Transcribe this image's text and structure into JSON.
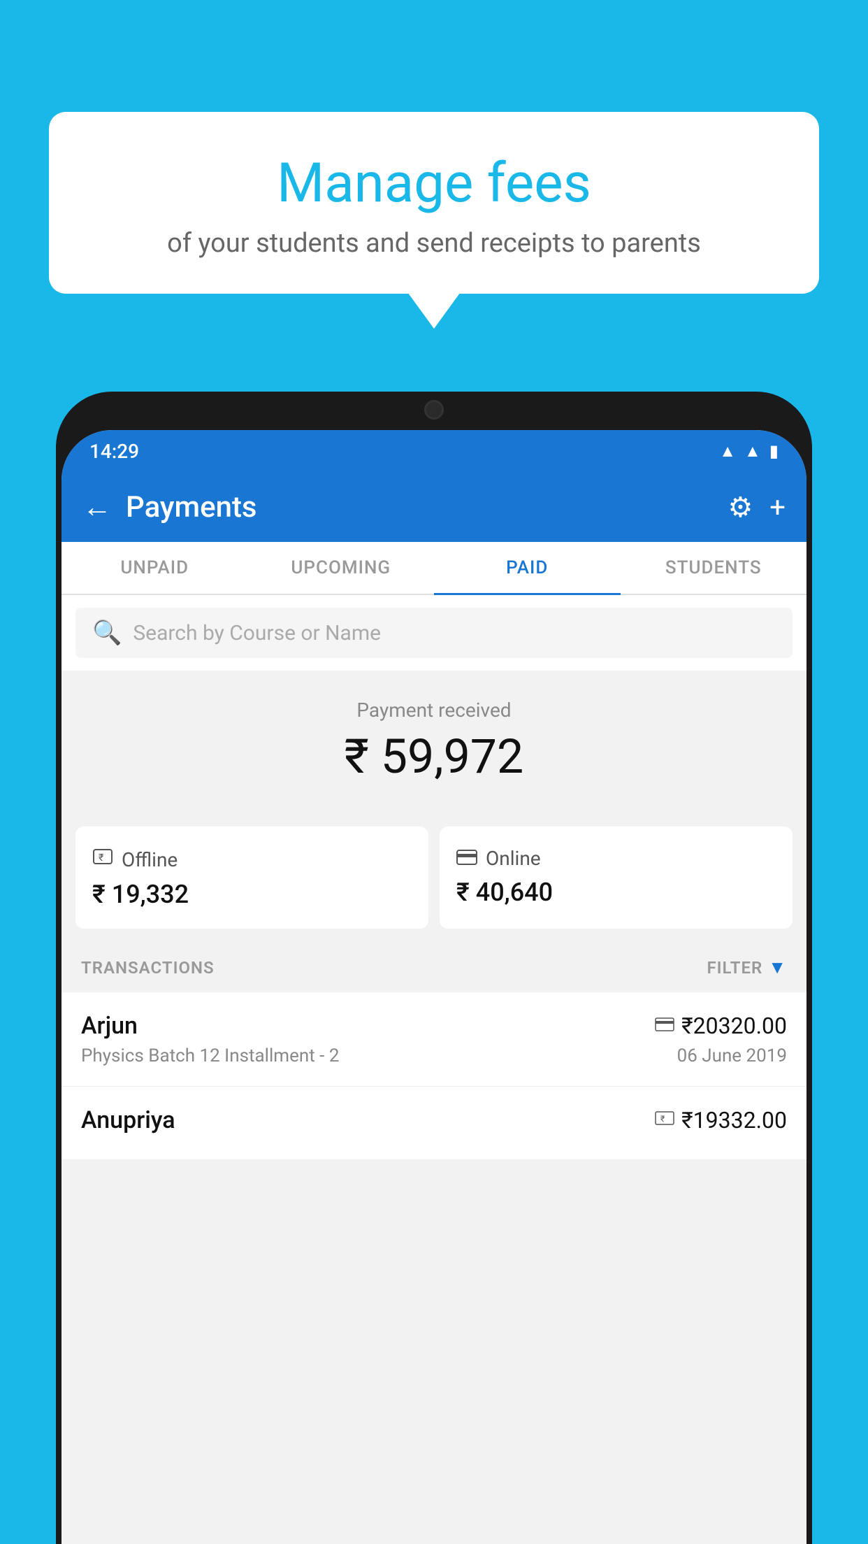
{
  "background_color": "#1ab8e8",
  "tooltip": {
    "title": "Manage fees",
    "subtitle": "of your students and send receipts to parents"
  },
  "status_bar": {
    "time": "14:29",
    "icons": [
      "wifi",
      "signal",
      "battery"
    ]
  },
  "app_bar": {
    "title": "Payments",
    "back_label": "←",
    "settings_label": "⚙",
    "add_label": "+"
  },
  "tabs": [
    {
      "label": "UNPAID",
      "active": false
    },
    {
      "label": "UPCOMING",
      "active": false
    },
    {
      "label": "PAID",
      "active": true
    },
    {
      "label": "STUDENTS",
      "active": false
    }
  ],
  "search": {
    "placeholder": "Search by Course or Name"
  },
  "payment_summary": {
    "label": "Payment received",
    "total": "₹ 59,972",
    "offline": {
      "type": "Offline",
      "amount": "₹ 19,332",
      "icon": "💳"
    },
    "online": {
      "type": "Online",
      "amount": "₹ 40,640",
      "icon": "💳"
    }
  },
  "transactions": {
    "label": "TRANSACTIONS",
    "filter_label": "FILTER",
    "items": [
      {
        "name": "Arjun",
        "amount": "₹20320.00",
        "course": "Physics Batch 12 Installment - 2",
        "date": "06 June 2019",
        "payment_mode": "card"
      },
      {
        "name": "Anupriya",
        "amount": "₹19332.00",
        "course": "",
        "date": "",
        "payment_mode": "cash"
      }
    ]
  }
}
